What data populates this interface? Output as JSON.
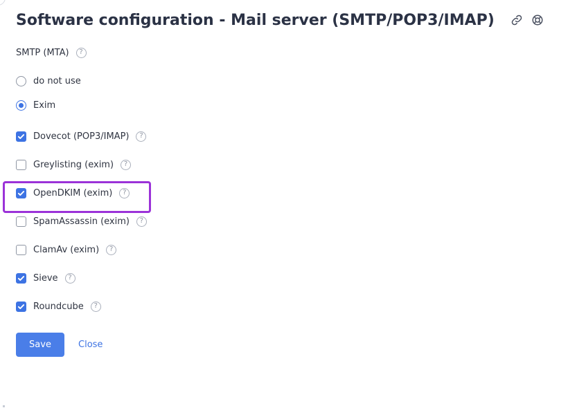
{
  "header": {
    "title": "Software configuration - Mail server (SMTP/POP3/IMAP)",
    "icons": [
      "link-icon",
      "help-center-icon"
    ]
  },
  "smtp": {
    "label": "SMTP (MTA)",
    "options": [
      {
        "label": "do not use",
        "selected": false
      },
      {
        "label": "Exim",
        "selected": true
      }
    ]
  },
  "components": [
    {
      "label": "Dovecot (POP3/IMAP)",
      "checked": true
    },
    {
      "label": "Greylisting (exim)",
      "checked": false
    },
    {
      "label": "OpenDKIM (exim)",
      "checked": true,
      "highlighted": true
    },
    {
      "label": "SpamAssassin (exim)",
      "checked": false
    },
    {
      "label": "ClamAv (exim)",
      "checked": false
    },
    {
      "label": "Sieve",
      "checked": true
    },
    {
      "label": "Roundcube",
      "checked": true
    }
  ],
  "help_glyph": "?",
  "actions": {
    "save_label": "Save",
    "close_label": "Close"
  },
  "colors": {
    "accent": "#3d73e3",
    "highlight": "#9b32d8",
    "title": "#2b3245"
  }
}
